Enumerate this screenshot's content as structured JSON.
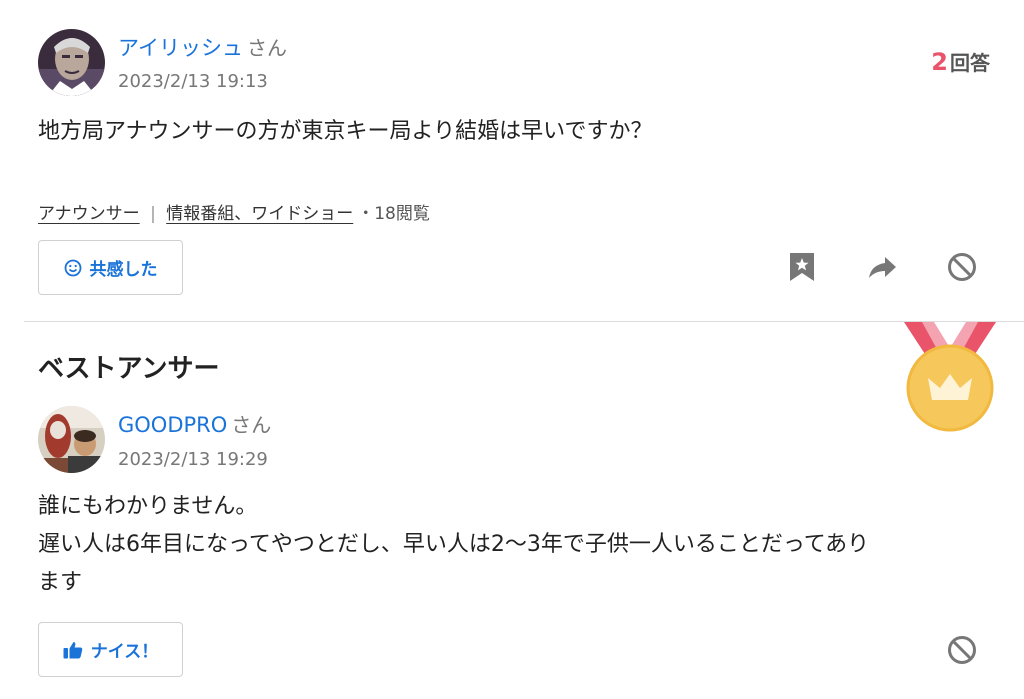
{
  "question": {
    "user": {
      "name": "アイリッシュ",
      "suffix": "さん",
      "date": "2023/2/13 19:13"
    },
    "answer_count": {
      "number": "2",
      "label": "回答"
    },
    "text": "地方局アナウンサーの方が東京キー局より結婚は早いですか？",
    "tags": [
      "アナウンサー",
      "情報番組、ワイドショー"
    ],
    "tag_separator": "|",
    "views": "・18閲覧",
    "empathy_button": "共感した",
    "icons": [
      "bookmark-icon",
      "share-icon",
      "block-icon"
    ]
  },
  "best_answer": {
    "title": "ベストアンサー",
    "medal_icon": "crown-medal-icon",
    "user": {
      "name": "GOODPRO",
      "suffix": "さん",
      "date": "2023/2/13 19:29"
    },
    "lines": [
      "誰にもわかりません。",
      "遅い人は6年目になってやつとだし、早い人は2〜3年で子供一人いることだってあり",
      "ます"
    ],
    "nice_button": "ナイス！",
    "icons": [
      "thumbs-up-icon",
      "block-icon"
    ]
  },
  "colors": {
    "link": "#1a73d9",
    "accent": "#e9546b",
    "medal": "#f6c75a",
    "ribbon": "#e9546b"
  }
}
